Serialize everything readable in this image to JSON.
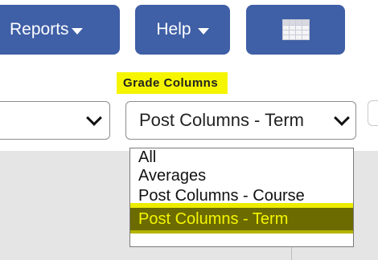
{
  "toolbar": {
    "reports_label": "Reports",
    "help_label": "Help",
    "grid_icon": "table-grid-icon"
  },
  "filters": {
    "grade_columns_label": "Grade Columns",
    "grade_columns_value": "Post Columns - Term",
    "options": [
      "All",
      "Averages",
      "Post Columns - Course",
      "Post Columns - Term"
    ],
    "highlight_color": "#f5f500",
    "selected_option_bg": "#6b6b00"
  },
  "colors": {
    "button_blue": "#3f5fa6",
    "panel_gray": "#e5e5e5"
  }
}
